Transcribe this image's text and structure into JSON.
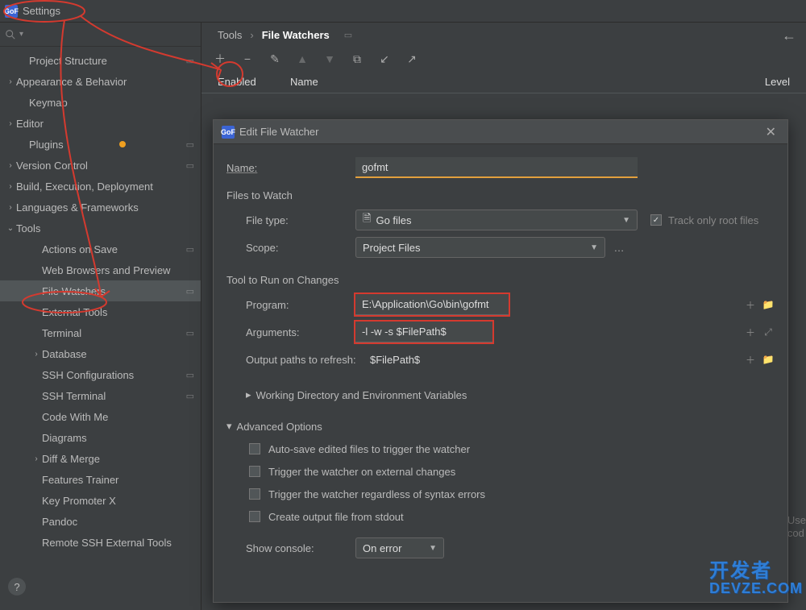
{
  "title": "Settings",
  "search": {
    "placeholder": ""
  },
  "sidebar": {
    "items": [
      {
        "label": "Project Structure",
        "indent": 1,
        "chev": "",
        "collapse": true
      },
      {
        "label": "Appearance & Behavior",
        "indent": 0,
        "chev": "›"
      },
      {
        "label": "Keymap",
        "indent": 1,
        "chev": ""
      },
      {
        "label": "Editor",
        "indent": 0,
        "chev": "›"
      },
      {
        "label": "Plugins",
        "indent": 1,
        "chev": "",
        "badge": true,
        "collapse": true
      },
      {
        "label": "Version Control",
        "indent": 0,
        "chev": "›",
        "collapse": true
      },
      {
        "label": "Build, Execution, Deployment",
        "indent": 0,
        "chev": "›"
      },
      {
        "label": "Languages & Frameworks",
        "indent": 0,
        "chev": "›"
      },
      {
        "label": "Tools",
        "indent": 0,
        "chev": "⌄",
        "expanded": true
      },
      {
        "label": "Actions on Save",
        "indent": 2,
        "chev": "",
        "collapse": true
      },
      {
        "label": "Web Browsers and Preview",
        "indent": 2,
        "chev": ""
      },
      {
        "label": "File Watchers",
        "indent": 2,
        "chev": "",
        "selected": true,
        "collapse": true
      },
      {
        "label": "External Tools",
        "indent": 2,
        "chev": ""
      },
      {
        "label": "Terminal",
        "indent": 2,
        "chev": "",
        "collapse": true
      },
      {
        "label": "Database",
        "indent": 2,
        "chev": "›"
      },
      {
        "label": "SSH Configurations",
        "indent": 2,
        "chev": "",
        "collapse": true
      },
      {
        "label": "SSH Terminal",
        "indent": 2,
        "chev": "",
        "collapse": true
      },
      {
        "label": "Code With Me",
        "indent": 2,
        "chev": ""
      },
      {
        "label": "Diagrams",
        "indent": 2,
        "chev": ""
      },
      {
        "label": "Diff & Merge",
        "indent": 2,
        "chev": "›"
      },
      {
        "label": "Features Trainer",
        "indent": 2,
        "chev": ""
      },
      {
        "label": "Key Promoter X",
        "indent": 2,
        "chev": ""
      },
      {
        "label": "Pandoc",
        "indent": 2,
        "chev": ""
      },
      {
        "label": "Remote SSH External Tools",
        "indent": 2,
        "chev": ""
      }
    ]
  },
  "breadcrumb": {
    "root": "Tools",
    "leaf": "File Watchers"
  },
  "columns": {
    "enabled": "Enabled",
    "name": "Name",
    "level": "Level"
  },
  "dialog": {
    "title": "Edit File Watcher",
    "name_label": "Name:",
    "name_value": "gofmt",
    "files_section": "Files to Watch",
    "filetype_label": "File type:",
    "filetype_value": "Go files",
    "track_root": "Track only root files",
    "scope_label": "Scope:",
    "scope_value": "Project Files",
    "tool_section": "Tool to Run on Changes",
    "program_label": "Program:",
    "program_value": "E:\\Application\\Go\\bin\\gofmt",
    "arguments_label": "Arguments:",
    "arguments_value": "-l -w -s $FilePath$",
    "output_label": "Output paths to refresh:",
    "output_value": "$FilePath$",
    "working_dir": "Working Directory and Environment Variables",
    "adv_section": "Advanced Options",
    "opt1": "Auto-save edited files to trigger the watcher",
    "opt2": "Trigger the watcher on external changes",
    "opt3": "Trigger the watcher regardless of syntax errors",
    "opt4": "Create output file from stdout",
    "console_label": "Show console:",
    "console_value": "On error"
  },
  "side_hint": {
    "l1": "Use",
    "l2": "cod"
  },
  "watermark": {
    "l1": "开发者",
    "l2": "DEVZE.COM"
  },
  "help": "?"
}
